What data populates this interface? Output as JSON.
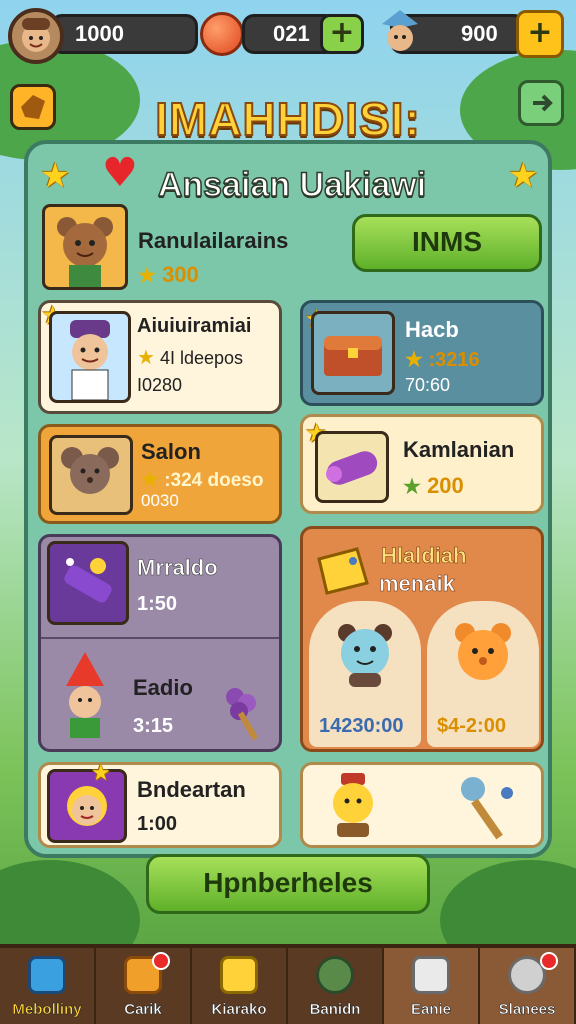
{
  "resources": {
    "coins": "1000",
    "gems": "021",
    "tokens": "900"
  },
  "title": "IMAHHDISI:",
  "subtitle": "Ansaian Uakiawi",
  "featured": {
    "name": "Ranulailarains",
    "price": "300",
    "button_label": "INMS"
  },
  "cards": [
    {
      "title": "Aiuiuiramiai",
      "line1": "4I  ldeepos",
      "line2": "I0280"
    },
    {
      "title": "Hacb",
      "line1": ":3216",
      "line2": "70:60"
    },
    {
      "title": "Salon",
      "line1": ":324  doeso",
      "line2": "0030"
    },
    {
      "title": "Kamlanian",
      "line1": "200"
    },
    {
      "title": "Mrraldo",
      "line1": "1:50"
    },
    {
      "title": "Eadio",
      "line1": "3:15"
    },
    {
      "title": "Bndeartan",
      "line1": "1:00"
    }
  ],
  "bundle": {
    "title": "Hlaldiah",
    "subtitle": "menaik",
    "price1": "14230:00",
    "price2": "$4-2:00"
  },
  "main_button": "Hpnberheles",
  "nav": [
    {
      "label": "Mebolliny"
    },
    {
      "label": "Carik"
    },
    {
      "label": "Kiarako"
    },
    {
      "label": "Banidn"
    },
    {
      "label": "Eanie"
    },
    {
      "label": "Slanees"
    }
  ],
  "colors": {
    "accent": "#ffd23a",
    "button_green": "#5fb02a",
    "panel": "#7cc7a9",
    "nav_bg": "#5a3a22",
    "price": "#d98f00"
  }
}
